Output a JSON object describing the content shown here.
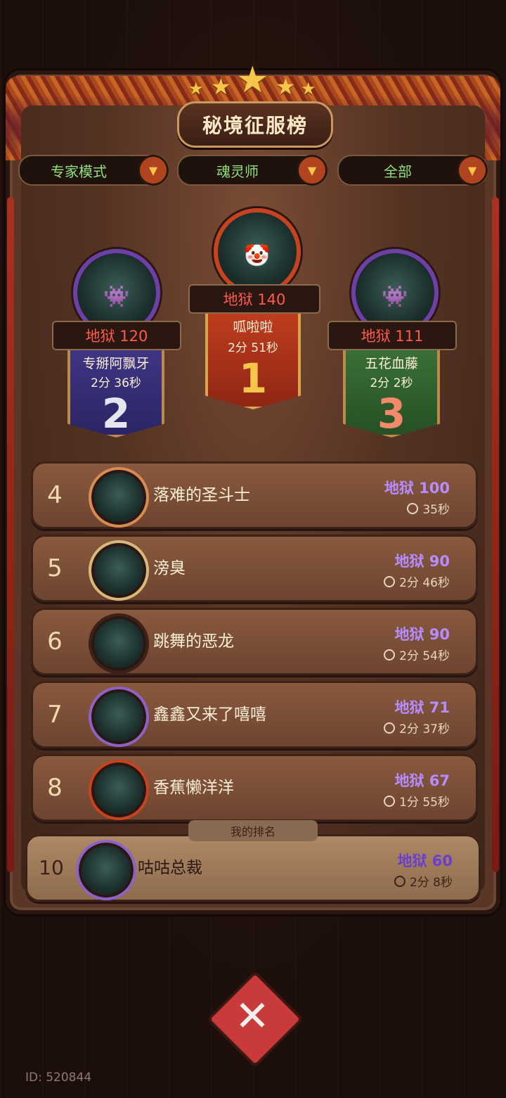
{
  "header": {
    "title": "秘境征服榜"
  },
  "filters": [
    {
      "label": "专家模式"
    },
    {
      "label": "魂灵师"
    },
    {
      "label": "全部"
    }
  ],
  "podium": {
    "first": {
      "rank": "1",
      "score": "地狱 140",
      "name": "呱啦啦",
      "time": "2分 51秒"
    },
    "second": {
      "rank": "2",
      "score": "地狱 120",
      "name": "专掰阿飘牙",
      "time": "2分 36秒"
    },
    "third": {
      "rank": "3",
      "score": "地狱 111",
      "name": "五花血藤",
      "time": "2分 2秒"
    }
  },
  "rows": [
    {
      "rank": "4",
      "name": "落难的圣斗士",
      "score": "地狱 100",
      "time": "35秒"
    },
    {
      "rank": "5",
      "name": "滂臭",
      "score": "地狱 90",
      "time": "2分 46秒"
    },
    {
      "rank": "6",
      "name": "跳舞的恶龙",
      "score": "地狱 90",
      "time": "2分 54秒"
    },
    {
      "rank": "7",
      "name": "鑫鑫又来了嘻嘻",
      "score": "地狱 71",
      "time": "2分 37秒"
    },
    {
      "rank": "8",
      "name": "香蕉懒洋洋",
      "score": "地狱 67",
      "time": "1分 55秒"
    }
  ],
  "my_rank": {
    "tab_label": "我的排名",
    "rank": "10",
    "name": "咕咕总裁",
    "score": "地狱 60",
    "time": "2分 8秒"
  },
  "footer": {
    "user_id": "ID: 520844"
  },
  "icons": {
    "close": "close-icon",
    "clock": "clock-icon",
    "dropdown": "chevron-down-icon",
    "star": "star-icon"
  }
}
